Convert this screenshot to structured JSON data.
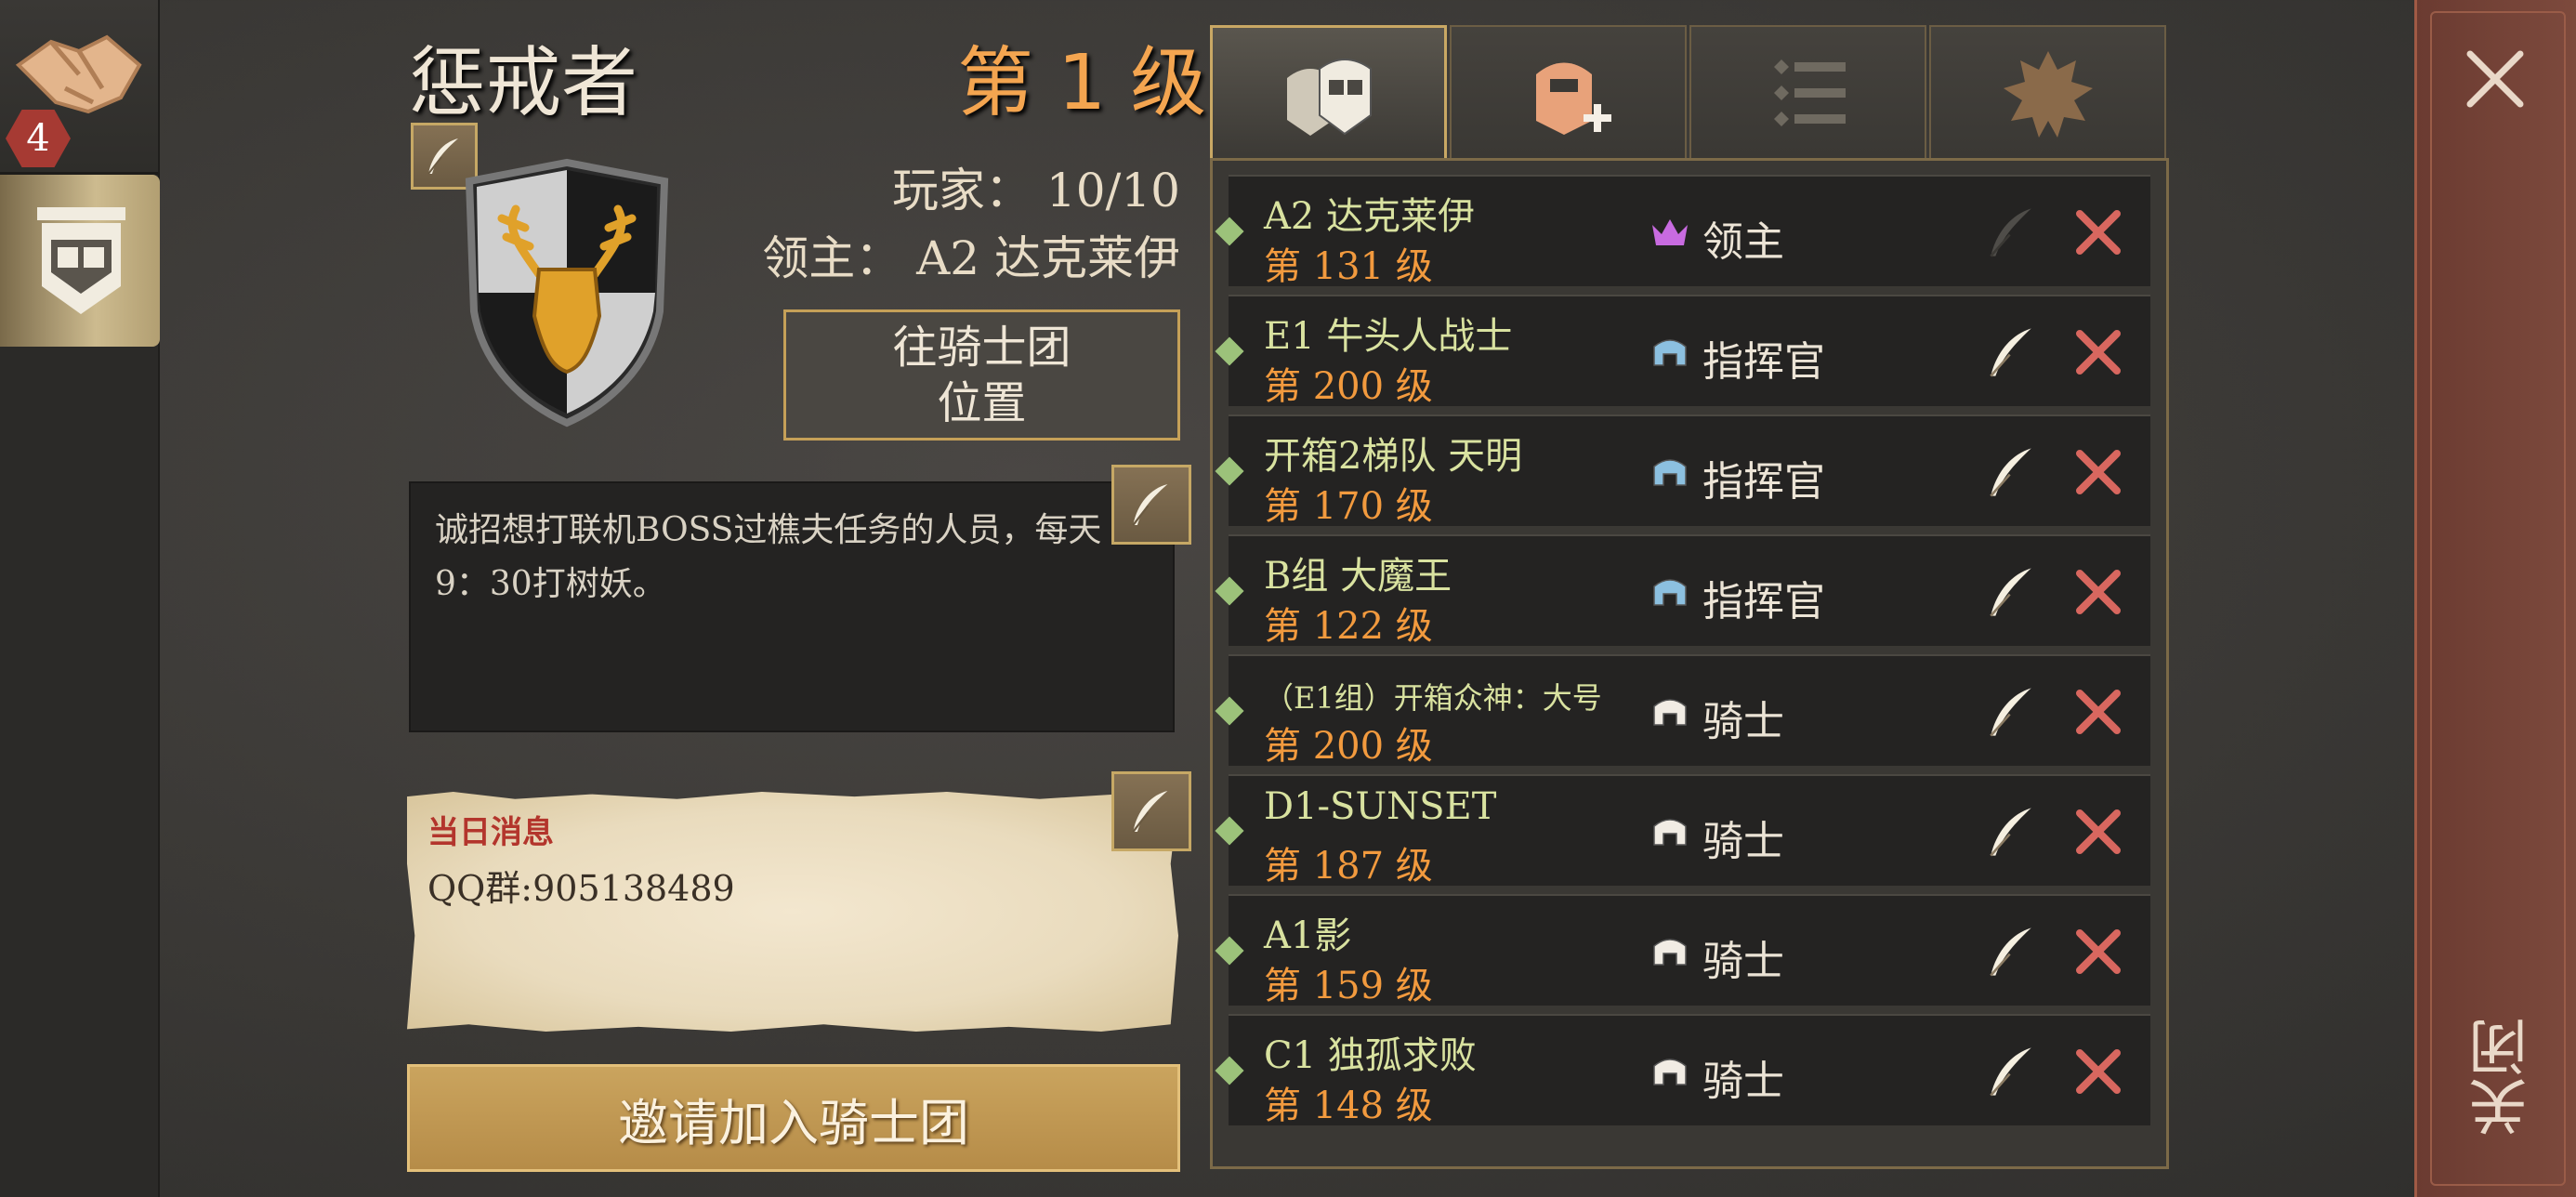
{
  "sidebar": {
    "badge_count": "4"
  },
  "guild": {
    "name": "惩戒者",
    "level": "第 1 级",
    "players": "玩家： 10/10",
    "lord": "领主： A2 达克莱伊",
    "location_button": {
      "line1": "往骑士团",
      "line2": "位置"
    },
    "description_line1": "诚招想打联机BOSS过樵夫任务的人员，每天",
    "description_line2": "9：30打树妖。",
    "daily_title": "当日消息",
    "daily_text": "QQ群:905138489",
    "invite_button": "邀请加入骑士团"
  },
  "close_label": "关闭",
  "colors": {
    "accent_gold": "#c9a864",
    "level_orange": "#f29a3e",
    "kick_red": "#d8675f",
    "name_green": "#d9e2a0"
  },
  "members": [
    {
      "name": "A2 达克莱伊",
      "level": "第 131 级",
      "role": "领主",
      "role_icon": "crown-icon"
    },
    {
      "name": "E1 牛头人战士",
      "level": "第 200 级",
      "role": "指挥官",
      "role_icon": "helmet-blue-icon"
    },
    {
      "name": "开箱2梯队 天明",
      "level": "第 170 级",
      "role": "指挥官",
      "role_icon": "helmet-blue-icon"
    },
    {
      "name": "B组 大魔王",
      "level": "第 122 级",
      "role": "指挥官",
      "role_icon": "helmet-blue-icon"
    },
    {
      "name": "（E1组）开箱众神：大号",
      "level": "第 200 级",
      "role": "骑士",
      "role_icon": "helmet-white-icon"
    },
    {
      "name": "D1-SUNSET",
      "level": "第 187 级",
      "role": "骑士",
      "role_icon": "helmet-white-icon"
    },
    {
      "name": "A1影",
      "level": "第 159 级",
      "role": "骑士",
      "role_icon": "helmet-white-icon"
    },
    {
      "name": "C1 独孤求败",
      "level": "第 148 级",
      "role": "骑士",
      "role_icon": "helmet-white-icon"
    }
  ]
}
